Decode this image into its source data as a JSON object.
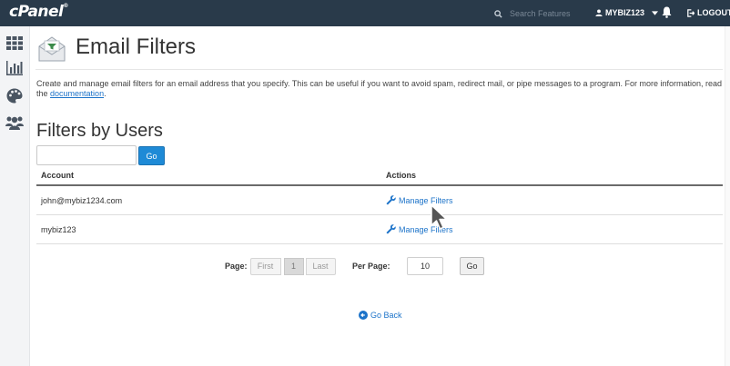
{
  "topbar": {
    "logo": "cPanel",
    "logo_mark": "®",
    "search_placeholder": "Search Features",
    "user": "MYBIZ123",
    "logout": "LOGOUT"
  },
  "sidebar": {
    "items": [
      {
        "icon": "grid-icon"
      },
      {
        "icon": "bar-chart-icon"
      },
      {
        "icon": "palette-icon"
      },
      {
        "icon": "users-icon"
      }
    ]
  },
  "page": {
    "title": "Email Filters",
    "description": "Create and manage email filters for an email address that you specify. This can be useful if you want to avoid spam, redirect mail, or pipe messages to a program. For more information, read the",
    "doc_link": "documentation",
    "doc_suffix": "."
  },
  "filters_by_users": {
    "heading": "Filters by Users",
    "search_value": "",
    "go_label": "Go",
    "columns": [
      "Account",
      "Actions"
    ],
    "rows": [
      {
        "account": "john@mybiz1234.com",
        "action": "Manage Filters"
      },
      {
        "account": "mybiz123",
        "action": "Manage Filters"
      }
    ]
  },
  "pagination": {
    "page_label": "Page:",
    "first": "First",
    "current": "1",
    "last": "Last",
    "per_page_label": "Per Page:",
    "per_page_value": "10",
    "go_label": "Go"
  },
  "go_back": "Go Back",
  "colors": {
    "topbar": "#293a4a",
    "link": "#1c73c9",
    "primary_button": "#1e8ad6"
  }
}
